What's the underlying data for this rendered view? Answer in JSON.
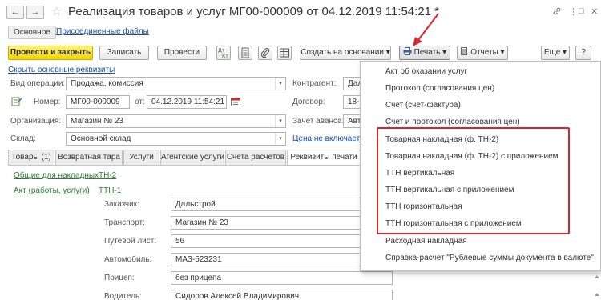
{
  "window": {
    "title": "Реализация товаров и услуг МГ00-000009 от 04.12.2019 11:54:21 *",
    "nav_back": "←",
    "nav_forward": "→",
    "star": "☆",
    "link_icon": "🔗",
    "more_icon": "⋮",
    "restore_icon": "□",
    "close_icon": "✕"
  },
  "form_tabs": {
    "main": "Основное",
    "attached": "Присоединенные файлы"
  },
  "toolbar": {
    "post_close": "Провести и закрыть",
    "save": "Записать",
    "post": "Провести",
    "create_based": "Создать на основании",
    "print": "Печать",
    "reports": "Отчеты",
    "more": "Еще",
    "help": "?",
    "dropdown_arrow": "▾",
    "dt_kt": "Дт Кт"
  },
  "requisites_link": "Скрыть основные реквизиты",
  "fields": {
    "operation_label": "Вид операции:",
    "operation_value": "Продажа, комиссия",
    "number_label": "Номер:",
    "number_value": "МГ00-000009",
    "date_label": "от:",
    "date_value": "04.12.2019 11:54:21",
    "org_label": "Организация:",
    "org_value": "Магазин № 23",
    "warehouse_label": "Склад:",
    "warehouse_value": "Основной склад",
    "contractor_label": "Контрагент:",
    "contractor_value": "Дал",
    "contract_label": "Договор:",
    "contract_value": "18-0",
    "advance_label": "Зачет аванса:",
    "advance_value": "Авт",
    "vat_link": "Цена не включает Н"
  },
  "detail_tabs": [
    "Товары (1)",
    "Возвратная тара",
    "Услуги",
    "Агентские услуги",
    "Счета расчетов",
    "Реквизиты печати"
  ],
  "print_req": {
    "common_link": "Общие для накладных",
    "tn2_link": "ТН-2",
    "act_link": "Акт (работы, услуги)",
    "ttn1_link": "ТТН-1",
    "customer_label": "Заказчик:",
    "customer_value": "Дальстрой",
    "transport_label": "Транспорт:",
    "transport_value": "Магазин № 23",
    "waybill_label": "Путевой лист:",
    "waybill_value": "56",
    "car_label": "Автомобиль:",
    "car_value": "МАЗ-523231",
    "trailer_label": "Прицеп:",
    "trailer_value": "без прицепа",
    "driver_label": "Водитель:",
    "driver_value": "Сидоров Алексей Владимирович"
  },
  "print_menu": [
    "Акт об оказании услуг",
    "Протокол (согласования цен)",
    "Счет (счет-фактура)",
    "Счет и протокол (согласования цен)",
    "Товарная накладная (ф. ТН-2)",
    "Товарная накладная (ф. ТН-2) с приложением",
    "ТТН вертикальная",
    "ТТН вертикальная с приложением",
    "ТТН горизонтальная",
    "ТТН горизонтальная с приложением",
    "Расходная накладная",
    "Справка-расчет \"Рублевые суммы документа в валюте\""
  ],
  "colors": {
    "accent_red": "#d7262c",
    "link_blue": "#1c4b9b",
    "primary_yellow": "#f1d400"
  }
}
